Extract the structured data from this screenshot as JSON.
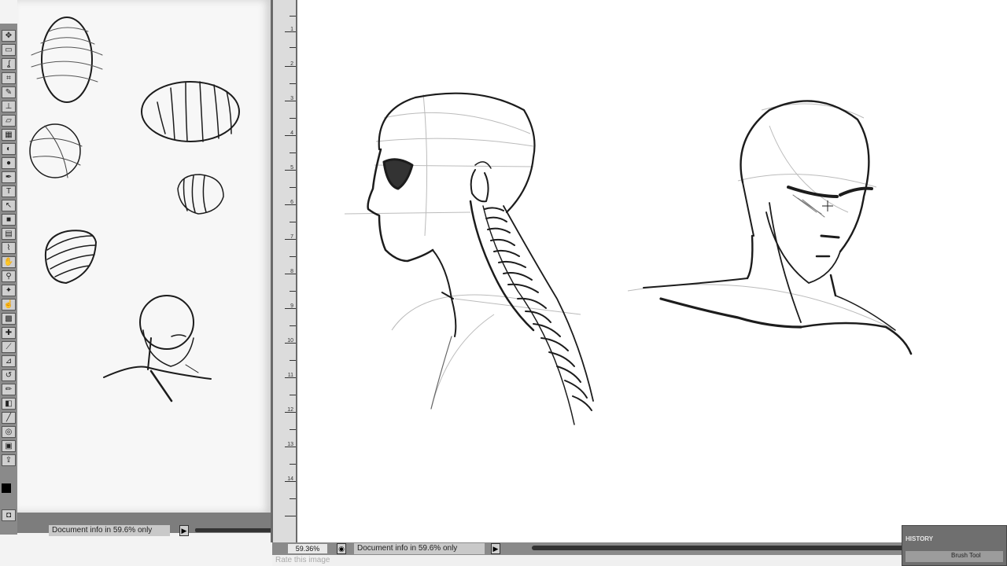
{
  "reference_window": {
    "status_text": "Document info in 59.6% only"
  },
  "main_window": {
    "zoom": "59.36%",
    "status_text": "Document info in 59.6% only"
  },
  "footer": {
    "label": "Rate this image"
  },
  "history_panel": {
    "title": "HISTORY",
    "item": "Brush Tool"
  },
  "ruler": {
    "numbers": [
      "1",
      "2",
      "3",
      "4",
      "5",
      "6",
      "7",
      "8",
      "9",
      "10",
      "11",
      "12",
      "13",
      "14"
    ]
  },
  "colors": {
    "sketch": "#1c1c1c",
    "canvas": "#ffffff",
    "chrome": "#8a8a8a"
  }
}
